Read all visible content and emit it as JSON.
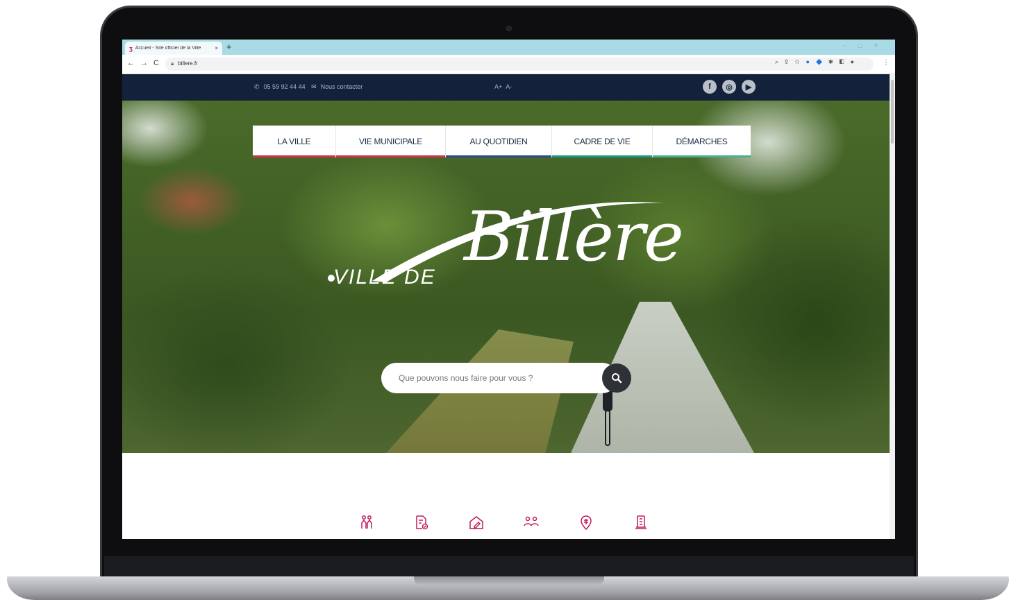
{
  "browser": {
    "tab_title": "Accueil - Site officiel de la Ville",
    "tab_close": "×",
    "new_tab": "+",
    "url": "billere.fr",
    "nav_back": "←",
    "nav_forward": "→",
    "nav_reload": "C",
    "menu": "⋮"
  },
  "topbar": {
    "phone": "05 59 92 44 44",
    "contact_label": "Nous contacter",
    "font_increase": "A+",
    "font_decrease": "A-",
    "social": [
      "f",
      "◎",
      "▶"
    ]
  },
  "nav": {
    "items": [
      {
        "label": "LA VILLE",
        "color": "#d2334a"
      },
      {
        "label": "VIE MUNICIPALE",
        "color": "#d2334a"
      },
      {
        "label": "AU QUOTIDIEN",
        "color": "#2b4a8a"
      },
      {
        "label": "CADRE DE VIE",
        "color": "#1a9a8c"
      },
      {
        "label": "DÉMARCHES",
        "color": "#48b08a"
      }
    ]
  },
  "logo": {
    "prefix": "VILLE DE",
    "name": "Billère"
  },
  "search": {
    "placeholder": "Que pouvons nous faire pour vous ?"
  },
  "quick_links": {
    "icons": [
      "family-icon",
      "document-check-icon",
      "house-edit-icon",
      "group-icon",
      "location-pin-icon",
      "building-column-icon"
    ],
    "color": "#c2185b"
  }
}
